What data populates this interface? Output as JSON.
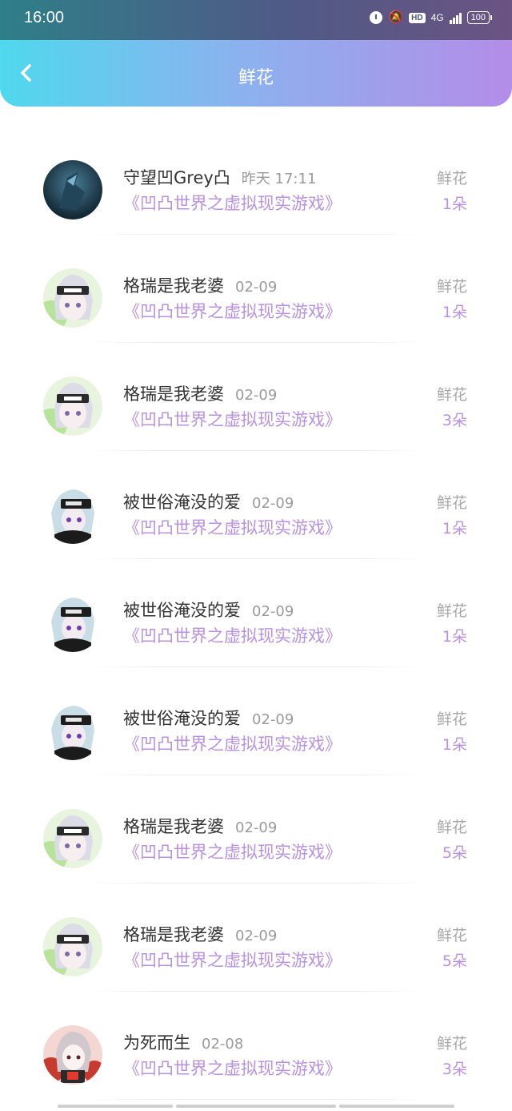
{
  "status": {
    "time": "16:00",
    "network": "4G",
    "battery": "100",
    "hd": "HD"
  },
  "header": {
    "title": "鲜花",
    "back_icon": "chevron-left-icon"
  },
  "entries": [
    {
      "name": "守望凹Grey凸",
      "time": "昨天 17:11",
      "book": "《凹凸世界之虚拟现实游戏》",
      "gift": "鲜花",
      "count": "1朵",
      "avatar": "dark-teal"
    },
    {
      "name": "格瑞是我老婆",
      "time": "02-09",
      "book": "《凹凸世界之虚拟现实游戏》",
      "gift": "鲜花",
      "count": "1朵",
      "avatar": "green-headband"
    },
    {
      "name": "格瑞是我老婆",
      "time": "02-09",
      "book": "《凹凸世界之虚拟现实游戏》",
      "gift": "鲜花",
      "count": "3朵",
      "avatar": "green-headband"
    },
    {
      "name": "被世俗淹没的爱",
      "time": "02-09",
      "book": "《凹凸世界之虚拟现实游戏》",
      "gift": "鲜花",
      "count": "1朵",
      "avatar": "dark-headband"
    },
    {
      "name": "被世俗淹没的爱",
      "time": "02-09",
      "book": "《凹凸世界之虚拟现实游戏》",
      "gift": "鲜花",
      "count": "1朵",
      "avatar": "dark-headband"
    },
    {
      "name": "被世俗淹没的爱",
      "time": "02-09",
      "book": "《凹凸世界之虚拟现实游戏》",
      "gift": "鲜花",
      "count": "1朵",
      "avatar": "dark-headband"
    },
    {
      "name": "格瑞是我老婆",
      "time": "02-09",
      "book": "《凹凸世界之虚拟现实游戏》",
      "gift": "鲜花",
      "count": "5朵",
      "avatar": "green-headband"
    },
    {
      "name": "格瑞是我老婆",
      "time": "02-09",
      "book": "《凹凸世界之虚拟现实游戏》",
      "gift": "鲜花",
      "count": "5朵",
      "avatar": "green-headband"
    },
    {
      "name": "为死而生",
      "time": "02-08",
      "book": "《凹凸世界之虚拟现实游戏》",
      "gift": "鲜花",
      "count": "3朵",
      "avatar": "red-character"
    }
  ]
}
